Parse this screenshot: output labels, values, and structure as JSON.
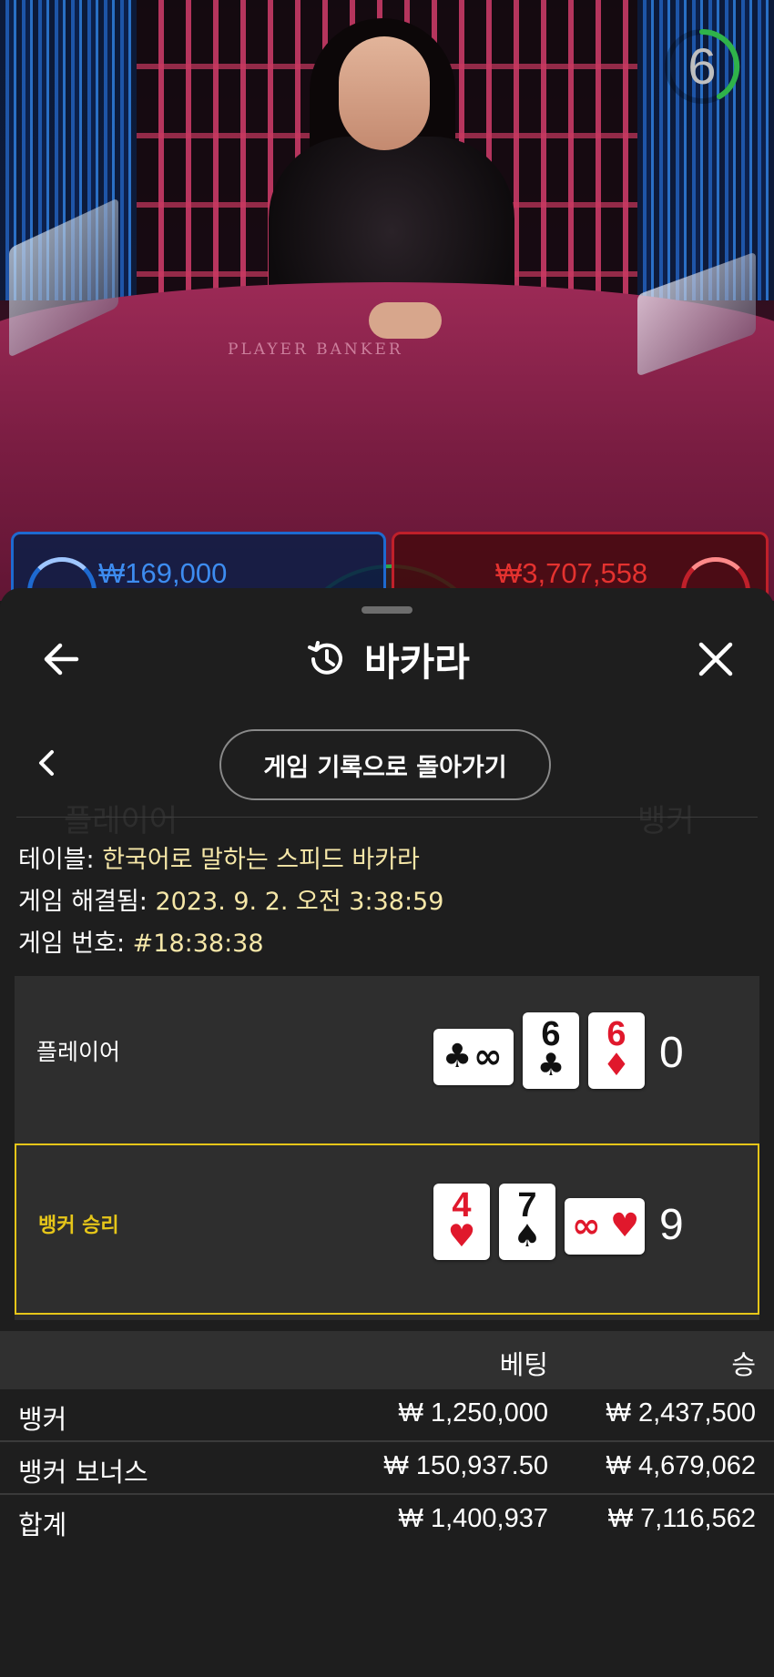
{
  "video": {
    "table_print": "PLAYER  BANKER",
    "timer_value": "6",
    "player_bet_total": "₩169,000",
    "banker_bet_total": "₩3,707,558"
  },
  "sheet": {
    "title": "바카라",
    "back_to_history_label": "게임 기록으로 돌아가기",
    "info": {
      "table_label": "테이블:",
      "table_value": "한국어로 말하는 스피드 바카라",
      "settled_label": "게임 해결됨:",
      "settled_value": "2023. 9. 2. 오전 3:38:59",
      "game_no_label": "게임 번호:",
      "game_no_value": "#18:38:38"
    },
    "player": {
      "label": "플레이어",
      "score": "0",
      "cards": [
        {
          "rank": "",
          "suit": "♣",
          "color": "#111111",
          "horizontal": true
        },
        {
          "rank": "6",
          "suit": "♣",
          "color": "#111111"
        },
        {
          "rank": "6",
          "suit": "♦",
          "color": "#e0182c"
        }
      ]
    },
    "banker": {
      "label": "뱅커 승리",
      "label_color": "#e6c619",
      "score": "9",
      "cards": [
        {
          "rank": "4",
          "suit": "♥",
          "color": "#e0182c"
        },
        {
          "rank": "7",
          "suit": "♠",
          "color": "#111111"
        },
        {
          "rank": "",
          "suit": "♥",
          "color": "#e0182c",
          "horizontal": true
        }
      ]
    },
    "bets_table": {
      "headers": {
        "bet": "베팅",
        "win": "승"
      },
      "rows": [
        {
          "label": "뱅커",
          "bet": "₩ 1,250,000",
          "win": "₩ 2,437,500"
        },
        {
          "label": "뱅커 보너스",
          "bet": "₩ 150,937.50",
          "win": "₩ 4,679,062"
        }
      ],
      "total": {
        "label": "합계",
        "bet": "₩ 1,400,937",
        "win": "₩ 7,116,562"
      }
    }
  },
  "colors": {
    "player_blue": "#1e6ad0",
    "banker_red": "#c0202a",
    "highlight_yellow": "#e6c619",
    "value_cream": "#f6e7a8"
  }
}
